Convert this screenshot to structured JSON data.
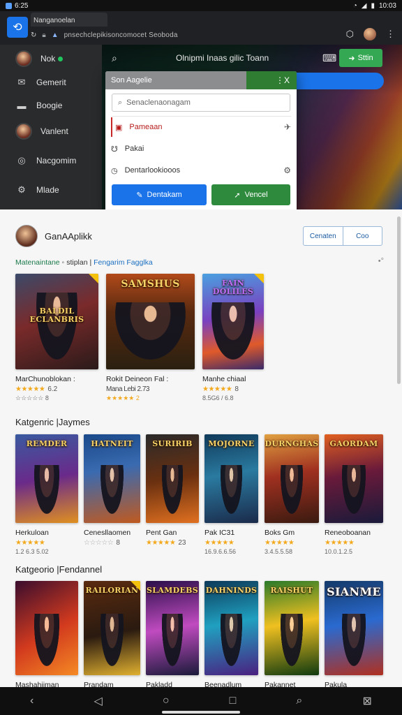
{
  "status": {
    "time": "6:25",
    "right_time": "10:03"
  },
  "browser": {
    "tab_title": "Nanganoelan",
    "url": "pnsechclepikisoncomocet Seoboda"
  },
  "sidebar": {
    "user": "Nok",
    "items": [
      {
        "label": "Gemerit",
        "icon": "send-icon"
      },
      {
        "label": "Boogie",
        "icon": "folder-icon"
      },
      {
        "label": "Vanlent",
        "icon": "avatar"
      },
      {
        "label": "Nacgomim",
        "icon": "target-icon"
      },
      {
        "label": "Mlade",
        "icon": "settings-icon"
      }
    ]
  },
  "hero": {
    "title": "Olnipmi Inaas gilic Toann",
    "signin_label": "Sttin"
  },
  "popup": {
    "title": "Son Aagelie",
    "close_label": "X",
    "search_placeholder": "Senaclenaonagam",
    "rows": [
      "Pameaan",
      "Pakai",
      "Dentarlookiooos"
    ],
    "btn_primary": "Dentakam",
    "btn_secondary": "Vencel"
  },
  "profile": {
    "name": "GanAAplikk",
    "seg_left": "Cenaten",
    "seg_right": "Coo"
  },
  "crumb": {
    "part1": "Matenaintane",
    "part2": "stiplan",
    "part3": "Fengarim Fagglka"
  },
  "featured": [
    {
      "title": "BALDIL\nECLANBRIS",
      "name": "MarChunoblokan  :",
      "rating": "★★★★★",
      "count": "6.2",
      "sub": "☆☆☆☆☆ 8"
    },
    {
      "title": "SAMSHUS",
      "name": "Rokit Deineon Fal  :",
      "rating": "Mana Lebi 2.73",
      "count": "",
      "sub": "★★★★★ 2"
    },
    {
      "title": "FAIN\nDOLILES",
      "name": "Manhe chiaal",
      "rating": "★★★★★",
      "count": "8",
      "sub": "8.5G6 / 6.8"
    }
  ],
  "section1": {
    "title": "Katgenric |Jaymes",
    "games": [
      {
        "title": "REMDER",
        "name": "Herkuloan",
        "rating": "★★★★★",
        "count": "",
        "sub": "1.2 6.3 5.02"
      },
      {
        "title": "HATNEIT",
        "name": "Cenesllaomen",
        "rating": "☆☆☆☆☆",
        "count": "8",
        "sub": ""
      },
      {
        "title": "SURIRIB",
        "name": "Pent Gan",
        "rating": "★★★★★",
        "count": "23",
        "sub": ""
      },
      {
        "title": "MOJORNE",
        "name": "Pak IC31",
        "rating": "★★★★★",
        "count": "",
        "sub": "16.9.6.6.56"
      },
      {
        "title": "DURNGHAS",
        "name": "Boks Gm",
        "rating": "★★★★★",
        "count": "",
        "sub": "3.4.5.5.58"
      },
      {
        "title": "GAORDAM",
        "name": "Reneoboanan",
        "rating": "★★★★★",
        "count": "",
        "sub": "10.0.1.2.5"
      }
    ]
  },
  "section2": {
    "title": "Katgeorio |Fendannel",
    "games": [
      {
        "title": "",
        "name": "Mashahiiman",
        "colors": [
          "#3a0d2e",
          "#d23a1e",
          "#f58a24"
        ]
      },
      {
        "title": "RAILORIAN",
        "name": "Prandam",
        "colors": [
          "#5a2b10",
          "#2a1a10",
          "#e0b030"
        ]
      },
      {
        "title": "SLAMDEBS",
        "name": "Pakladd",
        "colors": [
          "#2a0f4a",
          "#c04bc0",
          "#1a1a3a"
        ]
      },
      {
        "title": "DAHNINDS",
        "name": "Beenadlum",
        "colors": [
          "#0c3a5a",
          "#20a0c0",
          "#4a2080"
        ]
      },
      {
        "title": "RAISHUT",
        "name": "Pakannet",
        "colors": [
          "#2a7a2a",
          "#f0c020",
          "#103a10"
        ]
      },
      {
        "title": "SIANME",
        "name": "Pakula",
        "colors": [
          "#143a6a",
          "#2a6ad0",
          "#b03020"
        ]
      }
    ]
  },
  "colors": {
    "accent_green": "#34a853",
    "accent_blue": "#1a73e8"
  }
}
